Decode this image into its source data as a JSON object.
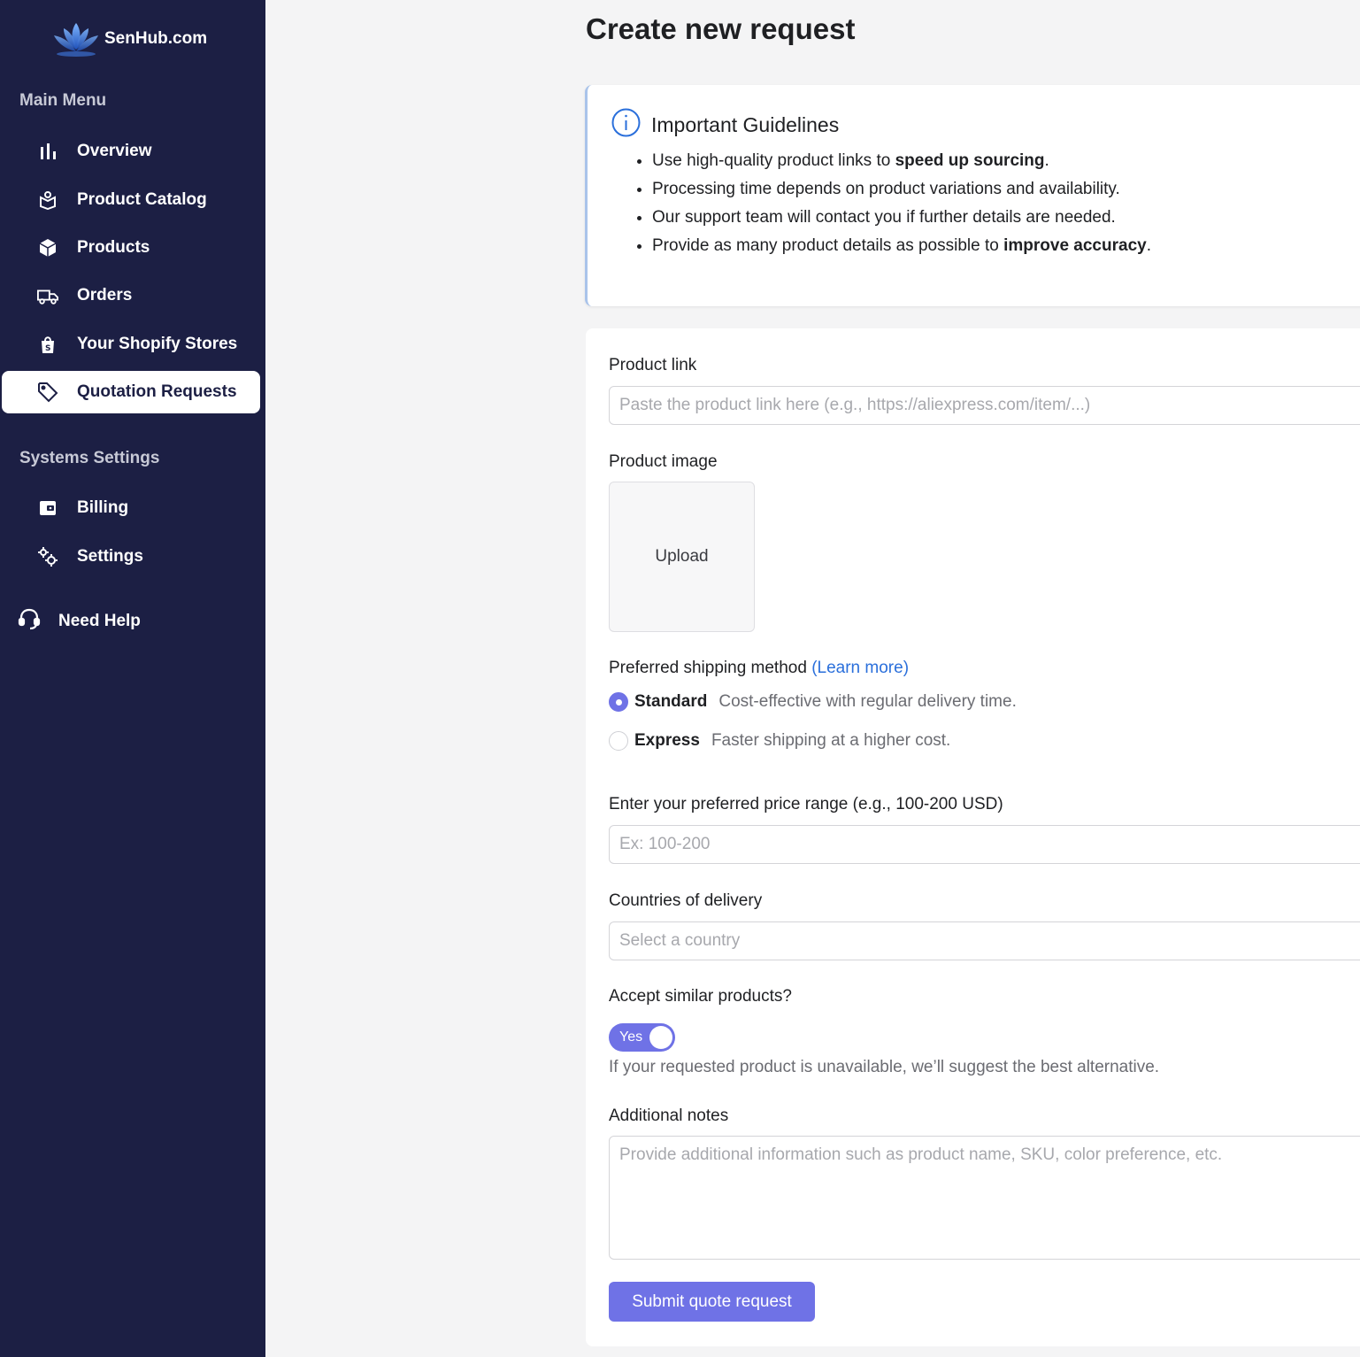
{
  "brand": {
    "name": "SenHub.com",
    "logo_icon": "lotus-logo-icon"
  },
  "sidebar": {
    "main_menu_title": "Main Menu",
    "main_items": [
      {
        "label": "Overview",
        "icon": "bar-chart-icon"
      },
      {
        "label": "Product Catalog",
        "icon": "catalog-box-icon"
      },
      {
        "label": "Products",
        "icon": "cube-icon"
      },
      {
        "label": "Orders",
        "icon": "delivery-truck-icon"
      },
      {
        "label": "Your Shopify Stores",
        "icon": "shopping-bag-icon"
      },
      {
        "label": "Quotation Requests",
        "icon": "tag-icon",
        "active": true
      }
    ],
    "settings_title": "Systems Settings",
    "settings_items": [
      {
        "label": "Billing",
        "icon": "wallet-icon"
      },
      {
        "label": "Settings",
        "icon": "gears-icon"
      }
    ],
    "help": {
      "label": "Need Help",
      "icon": "headset-icon"
    }
  },
  "page": {
    "title": "Create new request"
  },
  "guidelines": {
    "title": "Important Guidelines",
    "icon": "info-icon",
    "items": [
      {
        "pre": "Use high-quality product links to ",
        "bold": "speed up sourcing",
        "post": "."
      },
      {
        "pre": "Processing time depends on product variations and availability.",
        "bold": "",
        "post": ""
      },
      {
        "pre": "Our support team will contact you if further details are needed.",
        "bold": "",
        "post": ""
      },
      {
        "pre": "Provide as many product details as possible to ",
        "bold": "improve accuracy",
        "post": "."
      }
    ]
  },
  "form": {
    "product_link": {
      "label": "Product link",
      "placeholder": "Paste the product link here (e.g., https://aliexpress.com/item/...)",
      "value": ""
    },
    "product_image": {
      "label": "Product image",
      "upload_label": "Upload"
    },
    "shipping": {
      "label": "Preferred shipping method",
      "learn_more": "(Learn more)",
      "options": [
        {
          "title": "Standard",
          "description": "Cost-effective with regular delivery time.",
          "selected": true
        },
        {
          "title": "Express",
          "description": "Faster shipping at a higher cost.",
          "selected": false
        }
      ]
    },
    "price_range": {
      "label": "Enter your preferred price range (e.g., 100-200 USD)",
      "placeholder": "Ex: 100-200",
      "value": ""
    },
    "countries": {
      "label": "Countries of delivery",
      "placeholder": "Select a country",
      "value": ""
    },
    "similar": {
      "label": "Accept similar products?",
      "toggle_label": "Yes",
      "enabled": true,
      "help": "If your requested product is unavailable, we’ll suggest the best alternative."
    },
    "notes": {
      "label": "Additional notes",
      "placeholder": "Provide additional information such as product name, SKU, color preference, etc.",
      "value": ""
    },
    "submit_label": "Submit quote request"
  },
  "colors": {
    "sidebar_bg": "#1c1f44",
    "accent": "#6f72e6",
    "link": "#2a6fdb",
    "page_bg": "#f4f4f5"
  }
}
